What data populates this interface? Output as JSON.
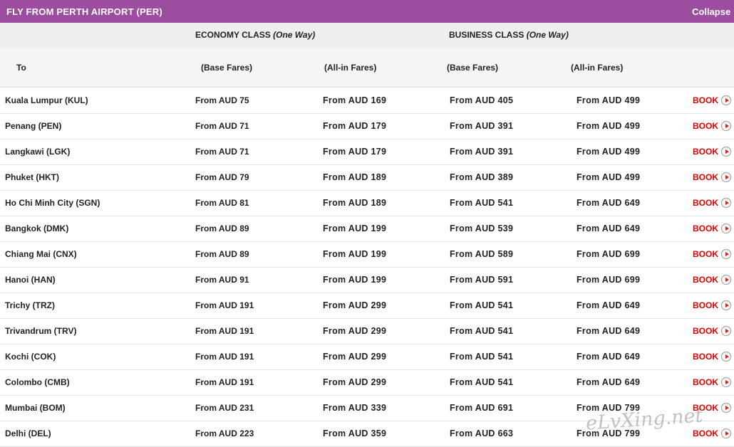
{
  "header": {
    "title": "FLY FROM PERTH AIRPORT (PER)",
    "collapse_label": "Collapse"
  },
  "classes": {
    "economy": {
      "name": "ECONOMY CLASS",
      "trip": "(One Way)"
    },
    "business": {
      "name": "BUSINESS CLASS",
      "trip": "(One Way)"
    }
  },
  "columns": {
    "to": "To",
    "eco_base": "(Base Fares)",
    "eco_allin": "(All-in Fares)",
    "bus_base": "(Base Fares)",
    "bus_allin": "(All-in Fares)"
  },
  "book_label": "BOOK",
  "routes": [
    {
      "dest": "Kuala Lumpur (KUL)",
      "eco_base": "From AUD 75",
      "eco_allin": "From AUD 169",
      "bus_base": "From AUD 405",
      "bus_allin": "From AUD 499"
    },
    {
      "dest": "Penang (PEN)",
      "eco_base": "From AUD 71",
      "eco_allin": "From AUD 179",
      "bus_base": "From AUD 391",
      "bus_allin": "From AUD 499"
    },
    {
      "dest": "Langkawi (LGK)",
      "eco_base": "From AUD 71",
      "eco_allin": "From AUD 179",
      "bus_base": "From AUD 391",
      "bus_allin": "From AUD 499"
    },
    {
      "dest": "Phuket (HKT)",
      "eco_base": "From AUD 79",
      "eco_allin": "From AUD 189",
      "bus_base": "From AUD 389",
      "bus_allin": "From AUD 499"
    },
    {
      "dest": "Ho Chi Minh City (SGN)",
      "eco_base": "From AUD 81",
      "eco_allin": "From AUD 189",
      "bus_base": "From AUD 541",
      "bus_allin": "From AUD 649"
    },
    {
      "dest": "Bangkok (DMK)",
      "eco_base": "From AUD 89",
      "eco_allin": "From AUD 199",
      "bus_base": "From AUD 539",
      "bus_allin": "From AUD 649"
    },
    {
      "dest": "Chiang Mai (CNX)",
      "eco_base": "From AUD 89",
      "eco_allin": "From AUD 199",
      "bus_base": "From AUD 589",
      "bus_allin": "From AUD 699"
    },
    {
      "dest": "Hanoi (HAN)",
      "eco_base": "From AUD 91",
      "eco_allin": "From AUD 199",
      "bus_base": "From AUD 591",
      "bus_allin": "From AUD 699"
    },
    {
      "dest": "Trichy (TRZ)",
      "eco_base": "From AUD 191",
      "eco_allin": "From AUD 299",
      "bus_base": "From AUD 541",
      "bus_allin": "From AUD 649"
    },
    {
      "dest": "Trivandrum (TRV)",
      "eco_base": "From AUD 191",
      "eco_allin": "From AUD 299",
      "bus_base": "From AUD 541",
      "bus_allin": "From AUD 649"
    },
    {
      "dest": "Kochi (COK)",
      "eco_base": "From AUD 191",
      "eco_allin": "From AUD 299",
      "bus_base": "From AUD 541",
      "bus_allin": "From AUD 649"
    },
    {
      "dest": "Colombo (CMB)",
      "eco_base": "From AUD 191",
      "eco_allin": "From AUD 299",
      "bus_base": "From AUD 541",
      "bus_allin": "From AUD 649"
    },
    {
      "dest": "Mumbai (BOM)",
      "eco_base": "From AUD 231",
      "eco_allin": "From AUD 339",
      "bus_base": "From AUD 691",
      "bus_allin": "From AUD 799"
    },
    {
      "dest": "Delhi (DEL)",
      "eco_base": "From AUD 223",
      "eco_allin": "From AUD 359",
      "bus_base": "From AUD 663",
      "bus_allin": "From AUD 799"
    }
  ],
  "watermark": "eLvXing.net"
}
